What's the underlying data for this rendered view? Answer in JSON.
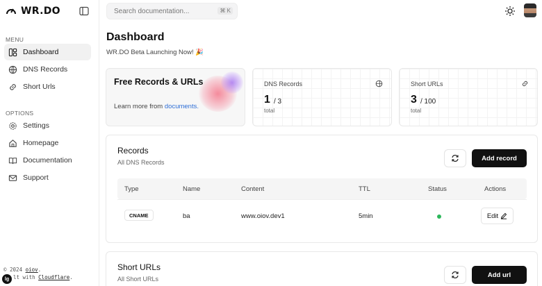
{
  "app": {
    "logo_text": "WR.DO"
  },
  "sidebar": {
    "menu_label": "MENU",
    "options_label": "OPTIONS",
    "menu_items": [
      {
        "label": "Dashboard",
        "icon": "dashboard-icon",
        "active": true
      },
      {
        "label": "DNS Records",
        "icon": "globe-icon"
      },
      {
        "label": "Short Urls",
        "icon": "link-icon"
      }
    ],
    "option_items": [
      {
        "label": "Settings",
        "icon": "gear-icon"
      },
      {
        "label": "Homepage",
        "icon": "home-icon"
      },
      {
        "label": "Documentation",
        "icon": "book-icon"
      },
      {
        "label": "Support",
        "icon": "mail-icon"
      }
    ],
    "footer_line1_prefix": "© 2024 ",
    "footer_line1_link": "oiov",
    "footer_line1_suffix": ".",
    "footer_line2_prefix": "lt with ",
    "footer_line2_link": "Cloudflare",
    "footer_line2_suffix": ".",
    "badge": "lg"
  },
  "topbar": {
    "search_placeholder": "Search documentation...",
    "search_shortcut": "⌘ K"
  },
  "page": {
    "title": "Dashboard",
    "subtitle": "WR.DO Beta Launching Now! 🎉"
  },
  "cards": {
    "free": {
      "title": "Free Records & URLs",
      "learn_prefix": "Learn more from ",
      "learn_link": "documents."
    },
    "dns": {
      "label": "DNS Records",
      "value": "1",
      "of": "/ 3",
      "total_label": "total"
    },
    "urls": {
      "label": "Short URLs",
      "value": "3",
      "of": "/ 100",
      "total_label": "total"
    }
  },
  "records": {
    "title": "Records",
    "subtitle": "All DNS Records",
    "add_label": "Add record",
    "columns": [
      "Type",
      "Name",
      "Content",
      "TTL",
      "Status",
      "Actions"
    ],
    "rows": [
      {
        "type": "CNAME",
        "name": "ba",
        "content": "www.oiov.dev1",
        "ttl": "5min",
        "status": "active",
        "action": "Edit"
      }
    ]
  },
  "short_urls": {
    "title": "Short URLs",
    "subtitle": "All Short URLs",
    "add_label": "Add url"
  },
  "colors": {
    "accent_link": "#2f6fd6",
    "status_active": "#2db75b",
    "primary_button": "#111111"
  }
}
